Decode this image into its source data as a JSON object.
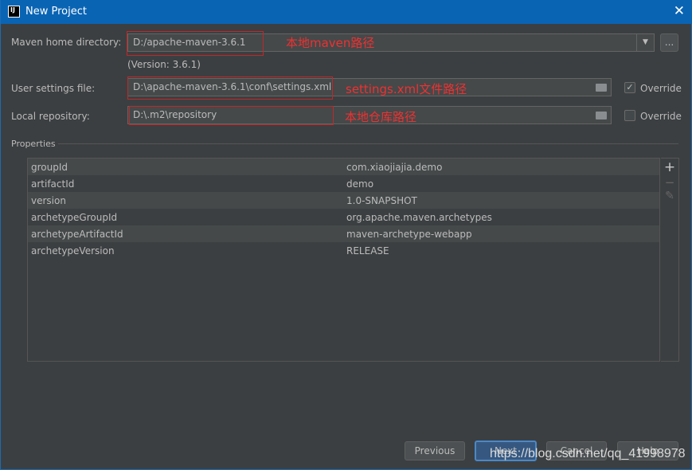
{
  "window": {
    "title": "New Project",
    "logo": "IJ"
  },
  "form": {
    "maven_home_label": "Maven home directory:",
    "maven_home_value": "D:/apache-maven-3.6.1",
    "maven_home_annotation": "本地maven路径",
    "browse_label": "...",
    "version": "(Version: 3.6.1)",
    "user_settings_label": "User settings file:",
    "user_settings_value": "D:\\apache-maven-3.6.1\\conf\\settings.xml",
    "user_settings_annotation": "settings.xml文件路径",
    "user_settings_override": "Override",
    "user_settings_override_checked": true,
    "local_repo_label": "Local repository:",
    "local_repo_value": "D:\\.m2\\repository",
    "local_repo_annotation": "本地仓库路径",
    "local_repo_override": "Override",
    "local_repo_override_checked": false
  },
  "properties": {
    "title": "Properties",
    "rows": [
      {
        "key": "groupId",
        "value": "com.xiaojiajia.demo"
      },
      {
        "key": "artifactId",
        "value": "demo"
      },
      {
        "key": "version",
        "value": "1.0-SNAPSHOT"
      },
      {
        "key": "archetypeGroupId",
        "value": "org.apache.maven.archetypes"
      },
      {
        "key": "archetypeArtifactId",
        "value": "maven-archetype-webapp"
      },
      {
        "key": "archetypeVersion",
        "value": "RELEASE"
      }
    ],
    "toolbar": {
      "add": "+",
      "remove": "−",
      "edit": "✎"
    }
  },
  "buttons": {
    "previous": "Previous",
    "next": "Next",
    "cancel": "Cancel",
    "help": "Help"
  },
  "watermark": "https://blog.csdn.net/qq_41998978"
}
